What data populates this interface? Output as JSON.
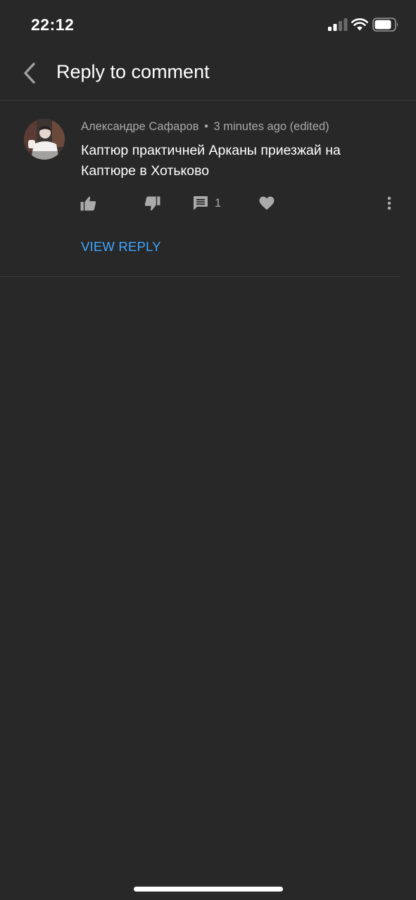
{
  "status_bar": {
    "time": "22:12"
  },
  "header": {
    "title": "Reply to comment",
    "back_icon": "chevron-left-icon"
  },
  "comment": {
    "author": "Александре Сафаров",
    "separator": "•",
    "timestamp": "3 minutes ago (edited)",
    "text": "Каптюр практичней Арканы приезжай на Каптюре в Хотьково",
    "actions": {
      "like_icon": "thumbs-up-icon",
      "dislike_icon": "thumbs-down-icon",
      "reply_icon": "comment-icon",
      "reply_count": "1",
      "heart_icon": "heart-icon",
      "more_icon": "more-vertical-icon"
    },
    "view_reply_label": "VIEW REPLY"
  },
  "colors": {
    "background": "#282828",
    "accent": "#3ea6ff",
    "secondary_text": "#a8a8a8",
    "icon": "#aaaaaa",
    "divider": "#3c3c3c"
  }
}
